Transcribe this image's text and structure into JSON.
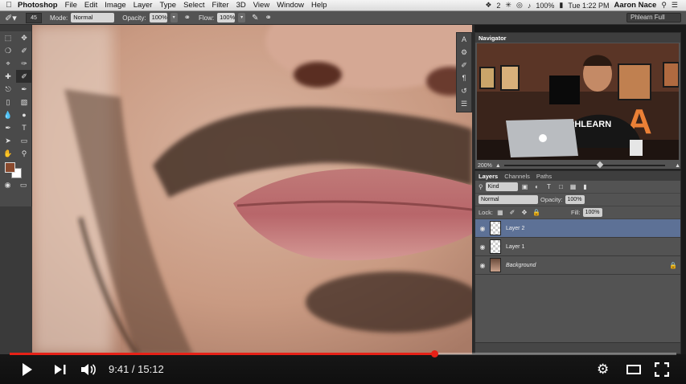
{
  "menubar": {
    "app_name": "Photoshop",
    "items": [
      "File",
      "Edit",
      "Image",
      "Layer",
      "Type",
      "Select",
      "Filter",
      "3D",
      "View",
      "Window",
      "Help"
    ],
    "clock": "Tue 1:22 PM",
    "user": "Aaron Nace",
    "badge": "2",
    "battery": "100%"
  },
  "options_bar": {
    "brush_size": "45",
    "mode_label": "Mode:",
    "mode_value": "Normal",
    "opacity_label": "Opacity:",
    "opacity_value": "100%",
    "flow_label": "Flow:",
    "flow_value": "100%",
    "workspace": "Phlearn Full"
  },
  "navigator": {
    "title": "Navigator",
    "zoom": "200%",
    "zoom_fraction": 0.58
  },
  "layers_panel": {
    "tabs": [
      "Layers",
      "Channels",
      "Paths"
    ],
    "filter_kind": "Kind",
    "blend_mode": "Normal",
    "opacity_label": "Opacity:",
    "opacity_value": "100%",
    "lock_label": "Lock:",
    "fill_label": "Fill:",
    "fill_value": "100%",
    "layers": [
      {
        "name": "Layer 2",
        "selected": true
      },
      {
        "name": "Layer 1",
        "selected": false
      },
      {
        "name": "Background",
        "selected": false,
        "locked": true
      }
    ]
  },
  "video": {
    "current_time": "9:41",
    "duration": "15:12",
    "time_display": "9:41 / 15:12",
    "played_fraction": 0.637
  },
  "colors": {
    "foreground": "#8a4a2e",
    "background": "#ffffff",
    "progress": "#e62117",
    "selected_layer": "#5d7196"
  }
}
